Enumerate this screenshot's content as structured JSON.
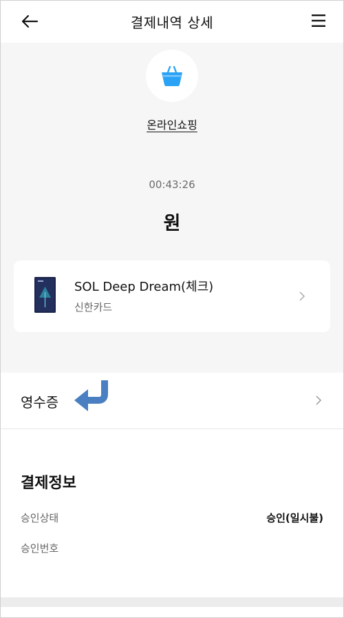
{
  "header": {
    "title": "결제내역 상세",
    "back_icon": "arrow-left-icon",
    "menu_icon": "hamburger-menu-icon"
  },
  "merchant": {
    "icon": "shopping-basket-icon",
    "icon_color": "#2aa2f5",
    "name": "온라인쇼핑"
  },
  "transaction": {
    "time": "00:43:26",
    "amount_unit": "원"
  },
  "card": {
    "name": "SOL Deep Dream(체크)",
    "issuer": "신한카드",
    "chevron_icon": "chevron-right-icon"
  },
  "receipt": {
    "label": "영수증",
    "hint_icon": "curved-arrow-left-icon",
    "hint_color": "#4a7fc1",
    "chevron_icon": "chevron-right-icon"
  },
  "payment_info": {
    "title": "결제정보",
    "rows": [
      {
        "label": "승인상태",
        "value": "승인(일시불)"
      },
      {
        "label": "승인번호",
        "value": ""
      }
    ]
  }
}
